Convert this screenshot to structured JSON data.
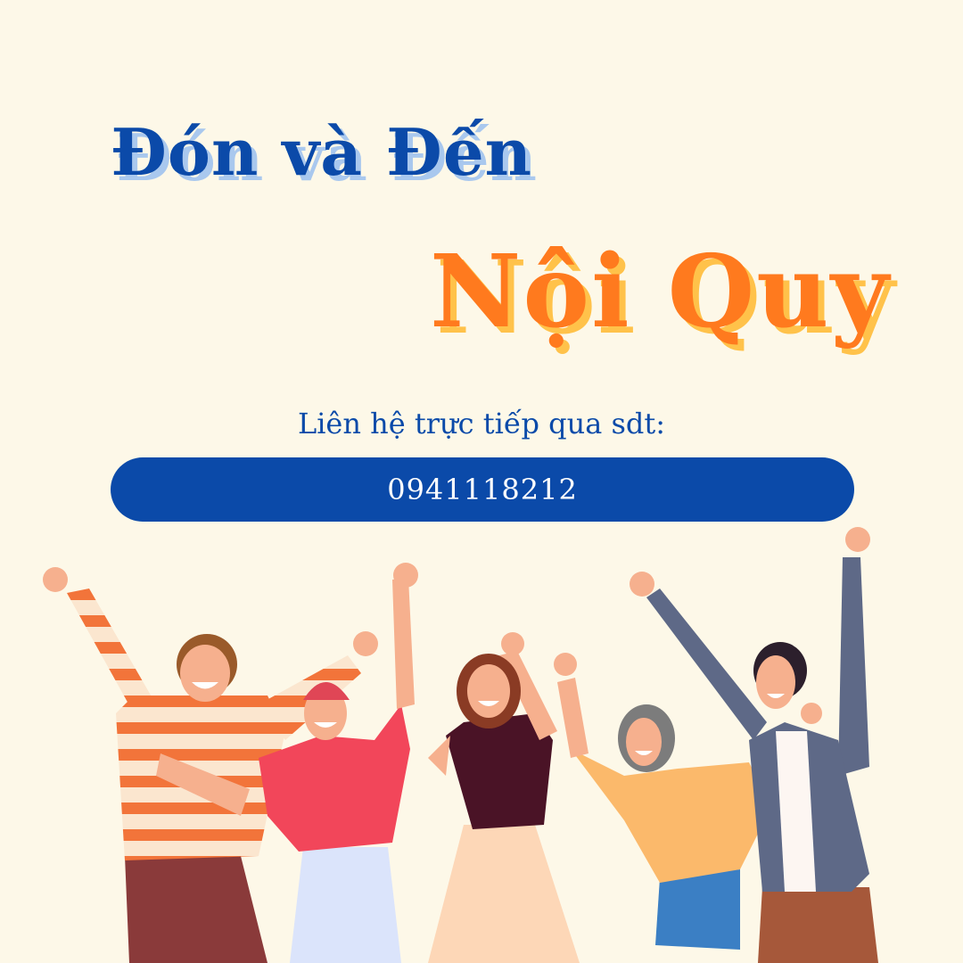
{
  "heading": {
    "line1": "Đón và Đến",
    "line2": "Nội Quy"
  },
  "contact": {
    "label": "Liên hệ trực tiếp qua sdt:",
    "phone": "0941118212"
  },
  "colors": {
    "background": "#fdf8e8",
    "primary_blue": "#0b4aa9",
    "accent_orange": "#ff7a1e",
    "orange_shadow": "#ffc24a",
    "blue_shadow": "#a9c8ee"
  },
  "illustration": {
    "subject": "group of five cheering people"
  }
}
